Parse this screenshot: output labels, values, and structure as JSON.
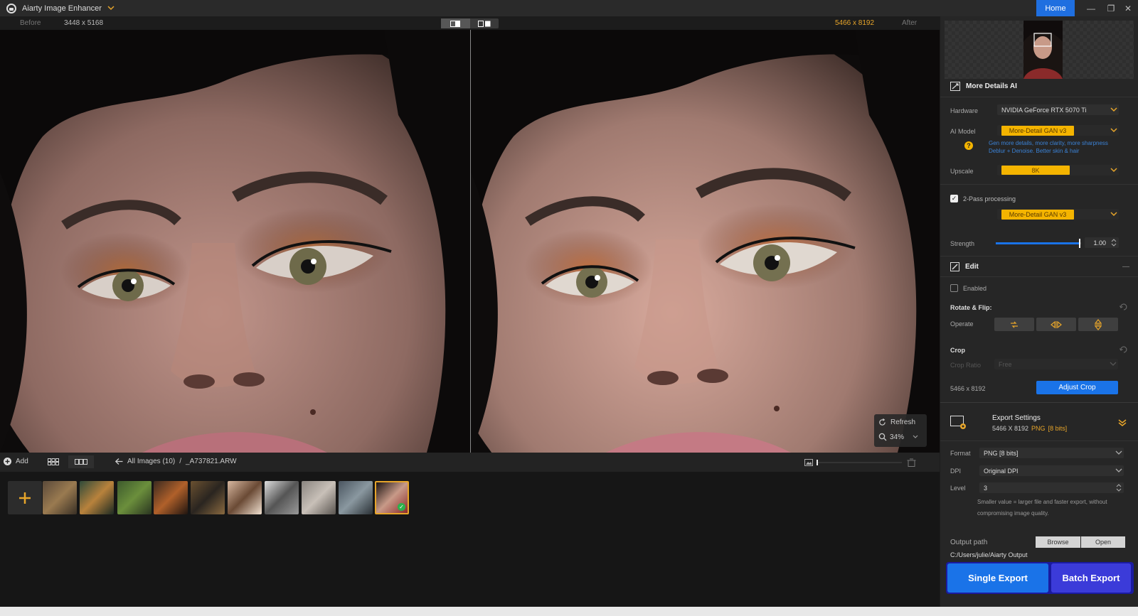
{
  "titlebar": {
    "app_title": "Aiarty Image Enhancer",
    "home_label": "Home",
    "minimize": "—",
    "maximize": "❐",
    "close": "✕"
  },
  "compare": {
    "before_label": "Before",
    "before_size": "3448 x 5168",
    "after_size": "5466 x 8192",
    "after_label": "After",
    "active_view": "side-by-side"
  },
  "viewer": {
    "refresh_label": "Refresh",
    "zoom_value": "34%"
  },
  "strip_bar": {
    "add_label": "Add",
    "breadcrumb_folder": "All Images (10)",
    "breadcrumb_sep": "/",
    "breadcrumb_file": "_A737821.ARW"
  },
  "thumbnails": [
    {
      "name": "thumb-leopard",
      "colors": [
        "#5a4a3a",
        "#9a7a50",
        "#3a3025"
      ]
    },
    {
      "name": "thumb-tiger",
      "colors": [
        "#2e4a3a",
        "#b8823c",
        "#1c2a22"
      ]
    },
    {
      "name": "thumb-forest-cottage",
      "colors": [
        "#3d5a2d",
        "#6b8f3c",
        "#2a3520"
      ]
    },
    {
      "name": "thumb-burger",
      "colors": [
        "#3a2a20",
        "#b0602a",
        "#201510"
      ]
    },
    {
      "name": "thumb-animal-portrait",
      "colors": [
        "#6a5030",
        "#2a2520",
        "#8a6a40"
      ]
    },
    {
      "name": "thumb-woman-portrait",
      "colors": [
        "#d8b8a0",
        "#6a4a35",
        "#f0e0d0"
      ]
    },
    {
      "name": "thumb-bw-scene",
      "colors": [
        "#dedede",
        "#555555",
        "#999999"
      ]
    },
    {
      "name": "thumb-standing-figure",
      "colors": [
        "#8a8580",
        "#c8c0b8",
        "#5a5550"
      ]
    },
    {
      "name": "thumb-dog",
      "colors": [
        "#4a5560",
        "#8a98a0",
        "#2a3035"
      ]
    },
    {
      "name": "thumb-current-portrait",
      "colors": [
        "#1c1412",
        "#c89a88",
        "#8a2a2a"
      ],
      "selected": true
    }
  ],
  "panel": {
    "section_title": "More Details AI",
    "hardware_label": "Hardware",
    "hardware_value": "NVIDIA GeForce RTX 5070 Ti",
    "ai_model_label": "AI Model",
    "ai_model_value": "More-Detail GAN  v3",
    "ai_model_desc_1": "Gen more details, more clarity, more sharpness",
    "ai_model_desc_2": "Deblur + Denoise. Better skin & hair",
    "help_symbol": "?",
    "upscale_label": "Upscale",
    "upscale_value": "8K",
    "two_pass_label": "2-Pass processing",
    "two_pass_checked": true,
    "two_pass_model": "More-Detail GAN  v3",
    "strength_label": "Strength",
    "strength_value": "1.00",
    "strength_fraction": 0.98,
    "edit_title": "Edit",
    "edit_collapse": "—",
    "enabled_label": "Enabled",
    "enabled_checked": false,
    "rotate_flip_title": "Rotate & Flip:",
    "operate_label": "Operate",
    "crop_title": "Crop",
    "crop_ratio_label": "Crop Ratio",
    "crop_ratio_value": "Free",
    "crop_size": "5466 x 8192",
    "adjust_crop_label": "Adjust Crop",
    "export_title": "Export Settings",
    "export_size": "5466 X 8192",
    "export_format_badge": "PNG",
    "export_bits_badge": "[8 bits]",
    "format_label": "Format",
    "format_value": "PNG  [8 bits]",
    "dpi_label": "DPI",
    "dpi_value": "Original DPI",
    "level_label": "Level",
    "level_value": "3",
    "level_hint_1": "Smaller value = larger file and faster export, without",
    "level_hint_2": "compromising image quality.",
    "output_path_label": "Output path",
    "browse_label": "Browse",
    "open_label": "Open",
    "output_path_value": "C:/Users/julie/Aiarty Output",
    "single_export_label": "Single Export",
    "batch_export_label": "Batch Export"
  },
  "colors": {
    "accent_blue": "#1a73e8",
    "accent_orange": "#f4b400",
    "batch_export_bg": "#3b3bd9"
  }
}
